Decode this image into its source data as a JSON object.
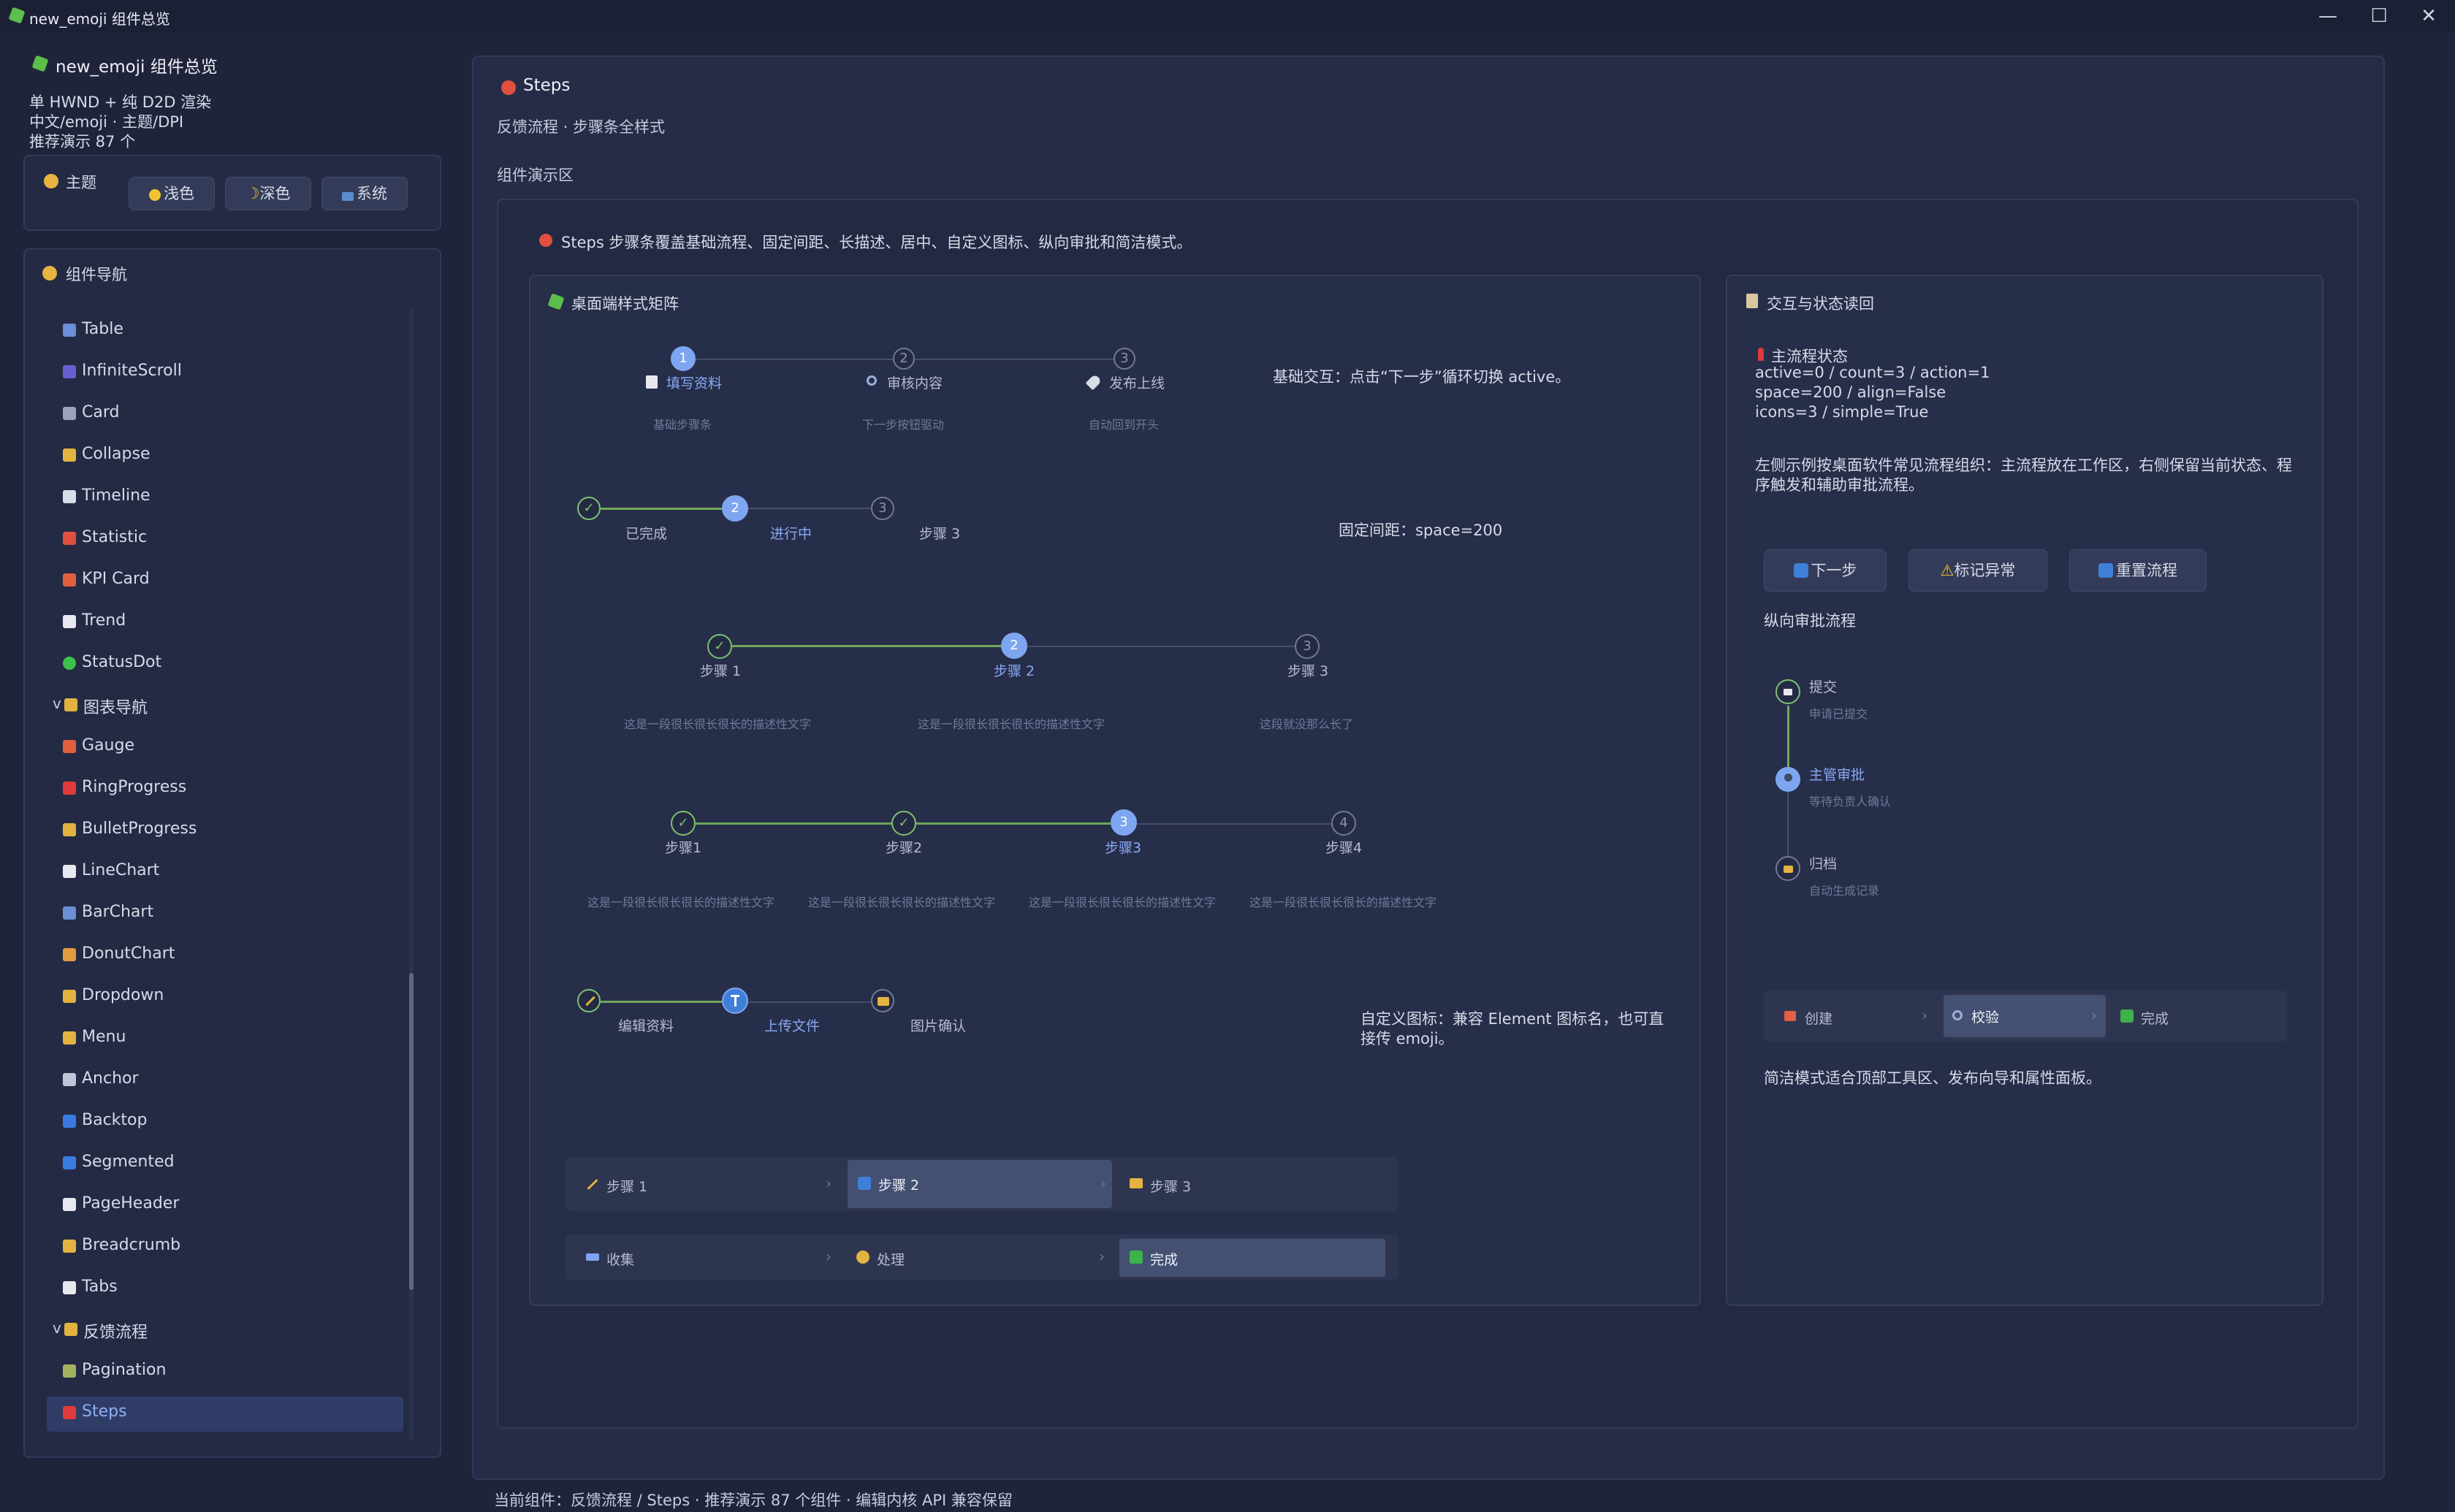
{
  "window": {
    "title": "new_emoji 组件总览",
    "min": "—",
    "max": "☐",
    "close": "✕"
  },
  "sidebar": {
    "app_title": "new_emoji 组件总览",
    "info": [
      "单 HWND + 纯 D2D 渲染",
      "中文/emoji · 主题/DPI",
      "推荐演示 87 个"
    ],
    "theme": {
      "label": "主题",
      "light": "浅色",
      "dark": "深色",
      "system": "系统"
    },
    "nav_title": "组件导航",
    "items": [
      {
        "label": "Table",
        "color": "#6b8fd6"
      },
      {
        "label": "InfiniteScroll",
        "color": "#6a5fd0"
      },
      {
        "label": "Card",
        "color": "#9aa3bb"
      },
      {
        "label": "Collapse",
        "color": "#e3b341"
      },
      {
        "label": "Timeline",
        "color": "#d8dde8"
      },
      {
        "label": "Statistic",
        "color": "#e0503d"
      },
      {
        "label": "KPI Card",
        "color": "#e06040"
      },
      {
        "label": "Trend",
        "color": "#e8e8f0"
      },
      {
        "label": "StatusDot",
        "color": "#3bc24a"
      },
      {
        "label": "图表导航",
        "color": "#e3b341",
        "group": true,
        "prefix": "v"
      },
      {
        "label": "Gauge",
        "color": "#e06040"
      },
      {
        "label": "RingProgress",
        "color": "#e03a3a"
      },
      {
        "label": "BulletProgress",
        "color": "#e3b341"
      },
      {
        "label": "LineChart",
        "color": "#e8e8f0"
      },
      {
        "label": "BarChart",
        "color": "#6b8fd6"
      },
      {
        "label": "DonutChart",
        "color": "#e39a41"
      },
      {
        "label": "Dropdown",
        "color": "#e3b341"
      },
      {
        "label": "Menu",
        "color": "#e3b341"
      },
      {
        "label": "Anchor",
        "color": "#c0c6d6"
      },
      {
        "label": "Backtop",
        "color": "#3a7be0"
      },
      {
        "label": "Segmented",
        "color": "#3a7be0"
      },
      {
        "label": "PageHeader",
        "color": "#e8e8f0"
      },
      {
        "label": "Breadcrumb",
        "color": "#e3b341"
      },
      {
        "label": "Tabs",
        "color": "#e8e8f0"
      },
      {
        "label": "反馈流程",
        "color": "#e3b341",
        "group": true,
        "prefix": "v"
      },
      {
        "label": "Pagination",
        "color": "#a3b060"
      },
      {
        "label": "Steps",
        "color": "#e03a3a",
        "selected": true
      }
    ]
  },
  "main": {
    "title": "Steps",
    "subtitle": "反馈流程 · 步骤条全样式",
    "section": "组件演示区",
    "intro": "Steps 步骤条覆盖基础流程、固定间距、长描述、居中、自定义图标、纵向审批和简洁模式。",
    "left_panel": {
      "title": "桌面端样式矩阵",
      "row1": {
        "steps": [
          {
            "num": "1",
            "label": "填写资料",
            "desc": "基础步骤条",
            "icon": "memo-icon"
          },
          {
            "num": "2",
            "label": "审核内容",
            "desc": "下一步按钮驱动",
            "icon": "magnifier-icon"
          },
          {
            "num": "3",
            "label": "发布上线",
            "desc": "自动回到开头",
            "icon": "rocket-icon"
          }
        ],
        "note": "基础交互：点击“下一步”循环切换 active。"
      },
      "row2": {
        "steps": [
          {
            "num": "✓",
            "label": "已完成"
          },
          {
            "num": "2",
            "label": "进行中"
          },
          {
            "num": "3",
            "label": "步骤 3"
          }
        ],
        "note": "固定间距：space=200"
      },
      "row3": {
        "steps": [
          {
            "num": "✓",
            "label": "步骤 1",
            "desc": "这是一段很长很长很长的描述性文字"
          },
          {
            "num": "2",
            "label": "步骤 2",
            "desc": "这是一段很长很长很长的描述性文字"
          },
          {
            "num": "3",
            "label": "步骤 3",
            "desc": "这段就没那么长了"
          }
        ]
      },
      "row4": {
        "steps": [
          {
            "num": "✓",
            "label": "步骤1",
            "desc": "这是一段很长很长很长的描述性文字"
          },
          {
            "num": "✓",
            "label": "步骤2",
            "desc": "这是一段很长很长很长的描述性文字"
          },
          {
            "num": "3",
            "label": "步骤3",
            "desc": "这是一段很长很长很长的描述性文字"
          },
          {
            "num": "4",
            "label": "步骤4",
            "desc": "这是一段很长很长很长的描述性文字"
          }
        ]
      },
      "row5": {
        "steps": [
          {
            "label": "编辑资料"
          },
          {
            "label": "上传文件"
          },
          {
            "label": "图片确认"
          }
        ],
        "note": "自定义图标：兼容 Element 图标名，也可直接传 emoji。"
      },
      "simple1": [
        "步骤 1",
        "步骤 2",
        "步骤 3"
      ],
      "simple2": [
        "收集",
        "处理",
        "完成"
      ]
    },
    "right_panel": {
      "title": "交互与状态读回",
      "state_title": "主流程状态",
      "state_lines": [
        "active=0 / count=3 / action=1",
        "space=200 / align=False",
        "icons=3 / simple=True"
      ],
      "desc": "左侧示例按桌面软件常见流程组织：主流程放在工作区，右侧保留当前状态、程序触发和辅助审批流程。",
      "buttons": {
        "next": "下一步",
        "mark": "标记异常",
        "reset": "重置流程"
      },
      "vertical_title": "纵向审批流程",
      "vertical": [
        {
          "label": "提交",
          "desc": "申请已提交"
        },
        {
          "label": "主管审批",
          "desc": "等待负责人确认"
        },
        {
          "label": "归档",
          "desc": "自动生成记录"
        }
      ],
      "simple": [
        "创建",
        "校验",
        "完成"
      ],
      "footer_note": "简洁模式适合顶部工具区、发布向导和属性面板。"
    },
    "status_bar": "当前组件：反馈流程 / Steps · 推荐演示 87 个组件 · 编辑内核 API 兼容保留"
  }
}
